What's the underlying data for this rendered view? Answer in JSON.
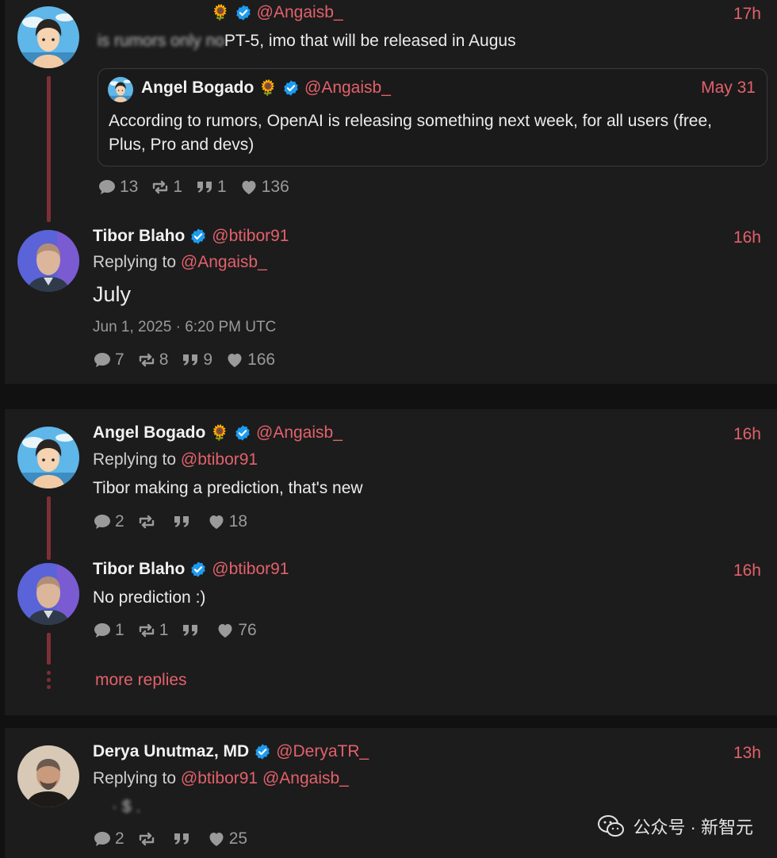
{
  "thread1": {
    "tweet1": {
      "handle": "@Angaisb_",
      "time": "17h",
      "text_tail": "PT-5, imo that will be released in Augus",
      "text_head": "is rumors only no",
      "quote": {
        "name": "Angel Bogado",
        "handle": "@Angaisb_",
        "date": "May 31",
        "line1": "According to rumors, OpenAI is releasing something next week, for all users (free,",
        "line2": "Plus, Pro and devs)"
      },
      "stats": {
        "replies": "13",
        "retweets": "1",
        "quotes": "1",
        "likes": "136"
      }
    },
    "tweet2": {
      "name": "Tibor Blaho",
      "handle": "@btibor91",
      "time": "16h",
      "replying_prefix": "Replying to",
      "replying_to": "@Angaisb_",
      "text": "July",
      "timestamp": "Jun 1, 2025 · 6:20 PM UTC",
      "stats": {
        "replies": "7",
        "retweets": "8",
        "quotes": "9",
        "likes": "166"
      }
    }
  },
  "thread2": {
    "tweet1": {
      "name": "Angel Bogado",
      "handle": "@Angaisb_",
      "time": "16h",
      "replying_prefix": "Replying to",
      "replying_to": "@btibor91",
      "text": "Tibor making a prediction, that's new",
      "stats": {
        "replies": "2",
        "retweets": "",
        "quotes": "",
        "likes": "18"
      }
    },
    "tweet2": {
      "name": "Tibor Blaho",
      "handle": "@btibor91",
      "time": "16h",
      "text": "No prediction :)",
      "stats": {
        "replies": "1",
        "retweets": "1",
        "quotes": "",
        "likes": "76"
      }
    },
    "more_replies": "more replies"
  },
  "thread3": {
    "tweet1": {
      "name": "Derya Unutmaz, MD",
      "handle": "@DeryaTR_",
      "time": "13h",
      "replying_prefix": "Replying to",
      "replying_to": [
        "@btibor91",
        "@Angaisb_"
      ],
      "text_blur": "· $ .",
      "stats": {
        "replies": "2",
        "retweets": "",
        "quotes": "",
        "likes": "25"
      }
    }
  },
  "watermark": {
    "text": "公众号 · 新智元",
    "icon": "wechat-icon"
  },
  "colors": {
    "accent": "#e3616b",
    "verified": "#1d9bf0",
    "thread_line": "#7e2f36",
    "background": "#111111",
    "panel": "#1c1c1c"
  }
}
